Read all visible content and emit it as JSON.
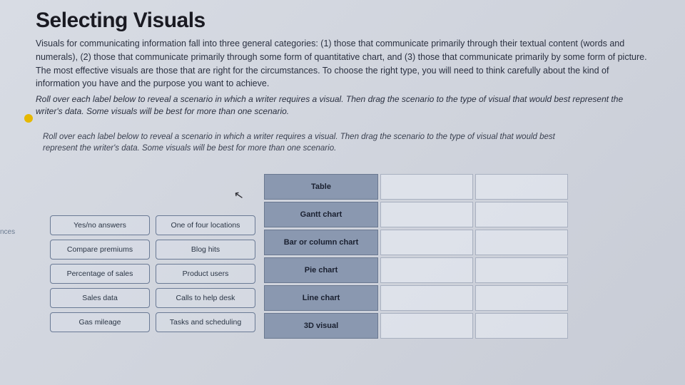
{
  "title": "Selecting Visuals",
  "intro": "Visuals for communicating information fall into three general categories: (1) those that communicate primarily through their textual content (words and numerals), (2) those that communicate primarily through some form of quantitative chart, and (3) those that communicate primarily by some form of picture. The most effective visuals are those that are right for the circumstances. To choose the right type, you will need to think carefully about the kind of information you have and the purpose you want to achieve.",
  "instruction1": "Roll over each label below to reveal a scenario in which a writer requires a visual. Then drag the scenario to the type of visual that would best represent the writer's data. Some visuals will be best for more than one scenario.",
  "instruction2": "Roll over each label below to reveal a scenario in which a writer requires a visual. Then drag the scenario to the type of visual that would best represent the writer's data. Some visuals will be best for more than one scenario.",
  "edgeLabel": "nces",
  "scenarios": [
    "Yes/no answers",
    "One of four locations",
    "Compare premiums",
    "Blog hits",
    "Percentage of sales",
    "Product users",
    "Sales data",
    "Calls to help desk",
    "Gas mileage",
    "Tasks and scheduling"
  ],
  "targets": [
    "Table",
    "Gantt chart",
    "Bar or column chart",
    "Pie chart",
    "Line chart",
    "3D visual"
  ]
}
